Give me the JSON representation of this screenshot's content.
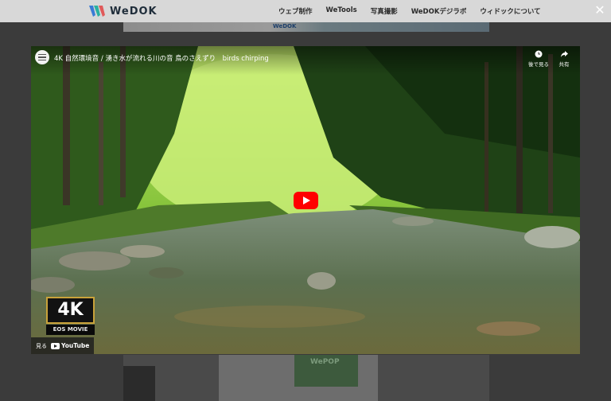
{
  "site": {
    "logo_text": "WeDOK",
    "nav": [
      "ウェブ制作",
      "WeTools",
      "写真撮影",
      "WeDOKデジラボ",
      "ウィドックについて"
    ],
    "banner_stamp": "WeDOK",
    "box_label": "WePOP"
  },
  "lightbox": {
    "close_glyph": "✕",
    "video": {
      "title": "4K 自然環境音 / 湧き水が流れる川の音 鳥のさえずり　birds chirping",
      "watch_later_label": "後で見る",
      "share_label": "共有",
      "badge_4k": "4K",
      "badge_camera": "EOS MOVIE",
      "watch_on_label": "見る",
      "youtube_label": "YouTube"
    }
  },
  "colors": {
    "overlay": "#3b3b3b",
    "play_button": "#ff0000",
    "badge_border": "#c9a23a"
  }
}
